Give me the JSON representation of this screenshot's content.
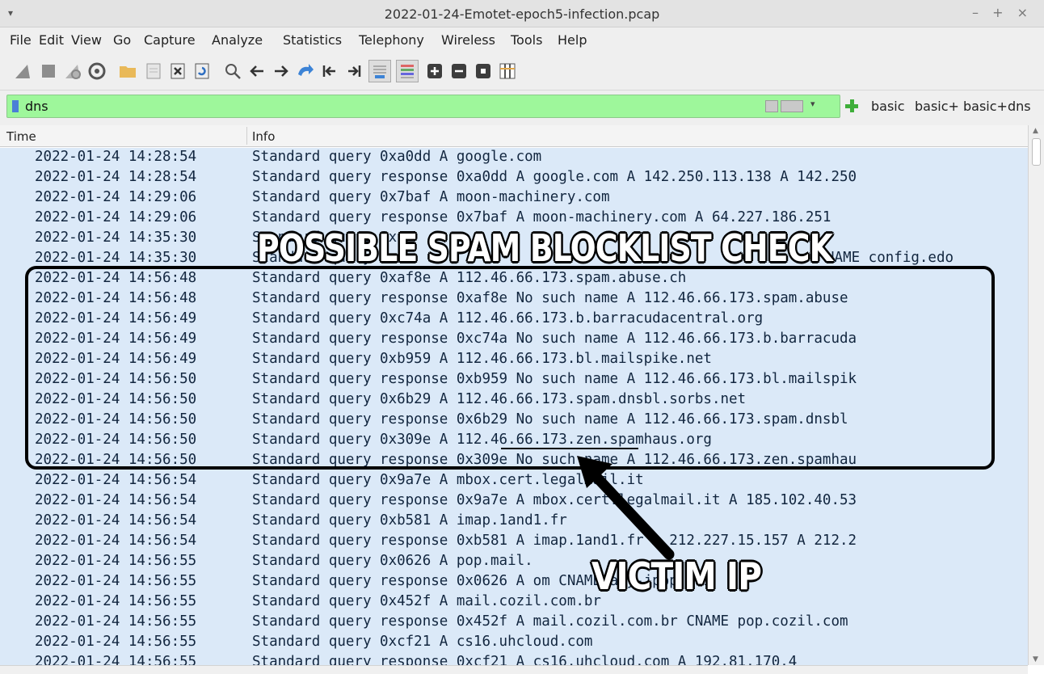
{
  "window": {
    "title": "2022-01-24-Emotet-epoch5-infection.pcap",
    "menu_glyph": "▾",
    "controls": "– + ×"
  },
  "menu": [
    "File",
    "Edit",
    "View",
    "Go",
    "Capture",
    "Analyze",
    "Statistics",
    "Telephony",
    "Wireless",
    "Tools",
    "Help"
  ],
  "filter": {
    "value": "dns",
    "buttons": [
      "basic",
      "basic+",
      "basic+dns"
    ]
  },
  "columns": {
    "time": "Time",
    "info": "Info"
  },
  "rows": [
    {
      "time": "2022-01-24 14:28:54",
      "info": "Standard query 0xa0dd A google.com"
    },
    {
      "time": "2022-01-24 14:28:54",
      "info": "Standard query response 0xa0dd A google.com A 142.250.113.138 A 142.250"
    },
    {
      "time": "2022-01-24 14:29:06",
      "info": "Standard query 0x7baf A moon-machinery.com"
    },
    {
      "time": "2022-01-24 14:29:06",
      "info": "Standard query response 0x7baf A moon-machinery.com A 64.227.186.251"
    },
    {
      "time": "2022-01-24 14:35:30",
      "info": "Standard query 0x"
    },
    {
      "time": "2022-01-24 14:35:30",
      "info": "Standard query re"
    },
    {
      "time": "2022-01-24 14:56:48",
      "info": "Standard query 0xaf8e A 112.46.66.173.spam.abuse.ch"
    },
    {
      "time": "2022-01-24 14:56:48",
      "info": "Standard query response 0xaf8e No such name A 112.46.66.173.spam.abuse"
    },
    {
      "time": "2022-01-24 14:56:49",
      "info": "Standard query 0xc74a A 112.46.66.173.b.barracudacentral.org"
    },
    {
      "time": "2022-01-24 14:56:49",
      "info": "Standard query response 0xc74a No such name A 112.46.66.173.b.barracuda"
    },
    {
      "time": "2022-01-24 14:56:49",
      "info": "Standard query 0xb959 A 112.46.66.173.bl.mailspike.net"
    },
    {
      "time": "2022-01-24 14:56:50",
      "info": "Standard query response 0xb959 No such name A 112.46.66.173.bl.mailspik"
    },
    {
      "time": "2022-01-24 14:56:50",
      "info": "Standard query 0x6b29 A 112.46.66.173.spam.dnsbl.sorbs.net"
    },
    {
      "time": "2022-01-24 14:56:50",
      "info": "Standard query response 0x6b29 No such name A 112.46.66.173.spam.dnsbl"
    },
    {
      "time": "2022-01-24 14:56:50",
      "info": "Standard query 0x309e A 112.46.66.173.zen.spamhaus.org"
    },
    {
      "time": "2022-01-24 14:56:50",
      "info": "Standard query response 0x309e No such name A 112.46.66.173.zen.spamhau"
    },
    {
      "time": "2022-01-24 14:56:54",
      "info": "Standard query 0x9a7e A mbox.cert.legalmail.it"
    },
    {
      "time": "2022-01-24 14:56:54",
      "info": "Standard query response 0x9a7e A mbox.cert.legalmail.it A 185.102.40.53"
    },
    {
      "time": "2022-01-24 14:56:54",
      "info": "Standard query 0xb581 A imap.1and1.fr"
    },
    {
      "time": "2022-01-24 14:56:54",
      "info": "Standard query response 0xb581 A imap.1and1.fr A 212.227.15.157 A 212.2"
    },
    {
      "time": "2022-01-24 14:56:55",
      "info": "Standard query 0x0626 A pop.mail."
    },
    {
      "time": "2022-01-24 14:56:55",
      "info": "Standard query response 0x0626 A              om CNAME any-jpop.mai"
    },
    {
      "time": "2022-01-24 14:56:55",
      "info": "Standard query 0x452f A mail.cozil.com.br"
    },
    {
      "time": "2022-01-24 14:56:55",
      "info": "Standard query response 0x452f A mail.cozil.com.br CNAME pop.cozil.com"
    },
    {
      "time": "2022-01-24 14:56:55",
      "info": "Standard query 0xcf21 A cs16.uhcloud.com"
    },
    {
      "time": "2022-01-24 14:56:55",
      "info": "Standard query response 0xcf21 A cs16.uhcloud.com A 192.81.170.4"
    }
  ],
  "row5_tail": "NAME config.edo",
  "annotations": {
    "headline": "POSSIBLE SPAM BLOCKLIST CHECK",
    "pointer": "VICTIM IP"
  }
}
